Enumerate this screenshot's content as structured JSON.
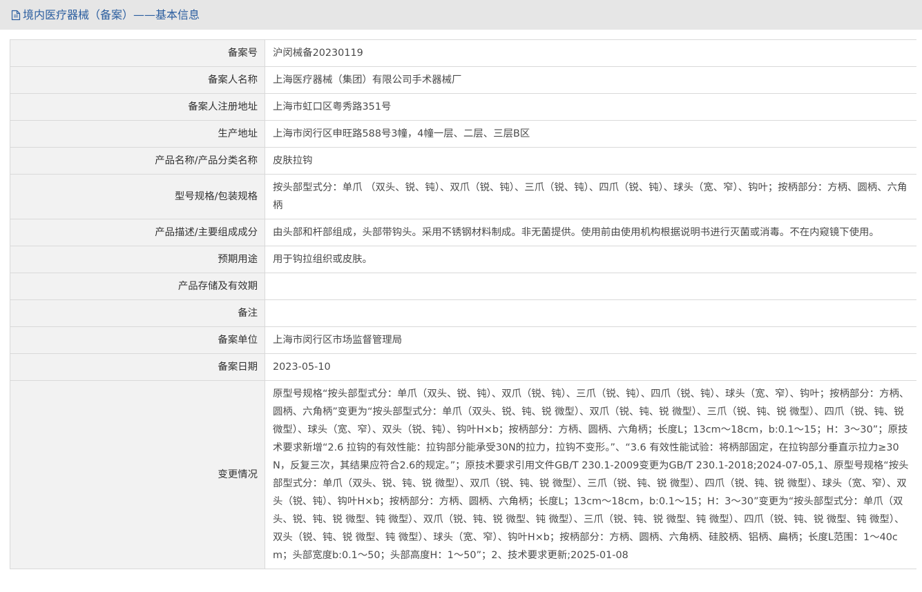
{
  "header": {
    "icon": "document-icon",
    "title": "境内医疗器械（备案）——基本信息",
    "title_color": "#2a5d9f"
  },
  "rows": [
    {
      "label": "备案号",
      "value": "沪闵械备20230119"
    },
    {
      "label": "备案人名称",
      "value": "上海医疗器械（集团）有限公司手术器械厂"
    },
    {
      "label": "备案人注册地址",
      "value": "上海市虹口区粤秀路351号"
    },
    {
      "label": "生产地址",
      "value": "上海市闵行区申旺路588号3幢，4幢一层、二层、三层B区"
    },
    {
      "label": "产品名称/产品分类名称",
      "value": "皮肤拉钩"
    },
    {
      "label": "型号规格/包装规格",
      "value": "按头部型式分：单爪 （双头、锐、钝）、双爪（锐、钝）、三爪（锐、钝）、四爪（锐、钝）、球头（宽、窄）、钩叶；按柄部分：方柄、圆柄、六角柄"
    },
    {
      "label": "产品描述/主要组成成分",
      "value": "由头部和杆部组成，头部带钩头。采用不锈钢材料制成。非无菌提供。使用前由使用机构根据说明书进行灭菌或消毒。不在内窥镜下使用。"
    },
    {
      "label": "预期用途",
      "value": "用于钩拉组织或皮肤。"
    },
    {
      "label": "产品存储及有效期",
      "value": ""
    },
    {
      "label": "备注",
      "value": ""
    },
    {
      "label": "备案单位",
      "value": "上海市闵行区市场监督管理局"
    },
    {
      "label": "备案日期",
      "value": "2023-05-10"
    },
    {
      "label": "变更情况",
      "value": "原型号规格“按头部型式分：单爪（双头、锐、钝）、双爪（锐、钝）、三爪（锐、钝）、四爪（锐、钝）、球头（宽、窄）、钩叶；按柄部分：方柄、圆柄、六角柄”变更为“按头部型式分：单爪（双头、锐、钝、锐 微型）、双爪（锐、钝、锐 微型）、三爪（锐、钝、锐 微型）、四爪（锐、钝、锐 微型）、球头（宽、窄）、双头（锐、钝）、钩叶H×b；按柄部分：方柄、圆柄、六角柄；长度L；13cm～18cm，b:0.1～15；H：3～30”；原技术要求新增“2.6 拉钩的有效性能：拉钩部分能承受30N的拉力，拉钩不变形。”、“3.6 有效性能试验：将柄部固定，在拉钩部分垂直示拉力≥30N，反复三次，其结果应符合2.6的规定。”；原技术要求引用文件GB/T 230.1-2009变更为GB/T 230.1-2018;2024-07-05,1、原型号规格“按头部型式分：单爪（双头、锐、钝、锐 微型）、双爪（锐、钝、锐 微型）、三爪（锐、钝、锐 微型）、四爪（锐、钝、锐 微型）、球头（宽、窄）、双头（锐、钝）、钩叶H×b；按柄部分：方柄、圆柄、六角柄；长度L；13cm～18cm，b:0.1～15；H：3～30”变更为“按头部型式分：单爪（双头、锐、钝、锐 微型、钝 微型）、双爪（锐、钝、锐 微型、钝 微型）、三爪（锐、钝、锐 微型、钝 微型）、四爪（锐、钝、锐 微型、钝 微型）、双头（锐、钝、锐 微型、钝 微型）、球头（宽、窄）、钩叶H×b；按柄部分：方柄、圆柄、六角柄、硅胶柄、铝柄、扁柄；长度L范围：1～40cm；头部宽度b:0.1～50；头部高度H：1～50”；2、技术要求更新;2025-01-08"
    }
  ]
}
